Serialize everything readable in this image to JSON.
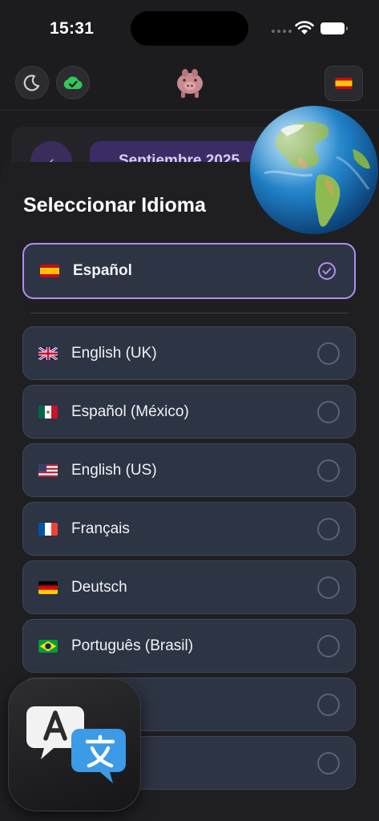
{
  "status_bar": {
    "time": "15:31"
  },
  "header": {
    "left_buttons": [
      "moon-icon",
      "cloud-check-icon"
    ],
    "logo": "piggy-bank-icon",
    "language_flag": "es"
  },
  "background": {
    "month_label": "Septiembre 2025"
  },
  "sheet": {
    "title": "Seleccionar Idioma",
    "selected": {
      "label": "Español",
      "flag": "es"
    },
    "languages": [
      {
        "label": "English (UK)",
        "flag": "uk"
      },
      {
        "label": "Español (México)",
        "flag": "mx"
      },
      {
        "label": "English (US)",
        "flag": "us"
      },
      {
        "label": "Français",
        "flag": "fr"
      },
      {
        "label": "Deutsch",
        "flag": "de"
      },
      {
        "label": "Português (Brasil)",
        "flag": "br"
      },
      {
        "label": "",
        "flag": ""
      },
      {
        "label": "",
        "flag": ""
      }
    ]
  },
  "colors": {
    "accent": "#b48cf0",
    "row_bg": "#2d3443",
    "sheet_bg": "#1f1f22",
    "cloud_green": "#34c759"
  },
  "overlays": {
    "globe": "globe-icon",
    "translate": "translate-app-icon"
  }
}
